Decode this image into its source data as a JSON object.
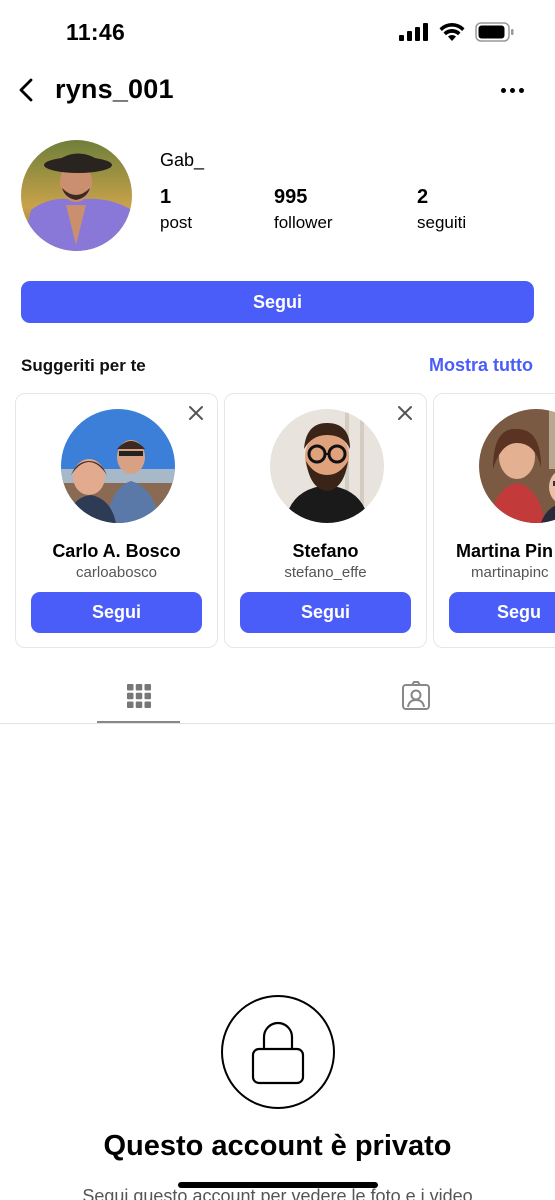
{
  "status_bar": {
    "time": "11:46"
  },
  "header": {
    "username": "ryns_001"
  },
  "profile": {
    "display_name": "Gab_",
    "stats": [
      {
        "value": "1",
        "label": "post"
      },
      {
        "value": "995",
        "label": "follower"
      },
      {
        "value": "2",
        "label": "seguiti"
      }
    ],
    "follow_label": "Segui"
  },
  "suggestions": {
    "title": "Suggeriti per te",
    "see_all": "Mostra tutto",
    "items": [
      {
        "name": "Carlo A. Bosco",
        "handle": "carloabosco",
        "follow_label": "Segui"
      },
      {
        "name": "Stefano",
        "handle": "stefano_effe",
        "follow_label": "Segui"
      },
      {
        "name": "Martina Pin",
        "handle": "martinapinc",
        "follow_label": "Segu"
      }
    ]
  },
  "private": {
    "title": "Questo account è privato",
    "subtitle": "Segui questo account per vedere le foto e i video"
  },
  "colors": {
    "accent": "#4a5df9"
  }
}
